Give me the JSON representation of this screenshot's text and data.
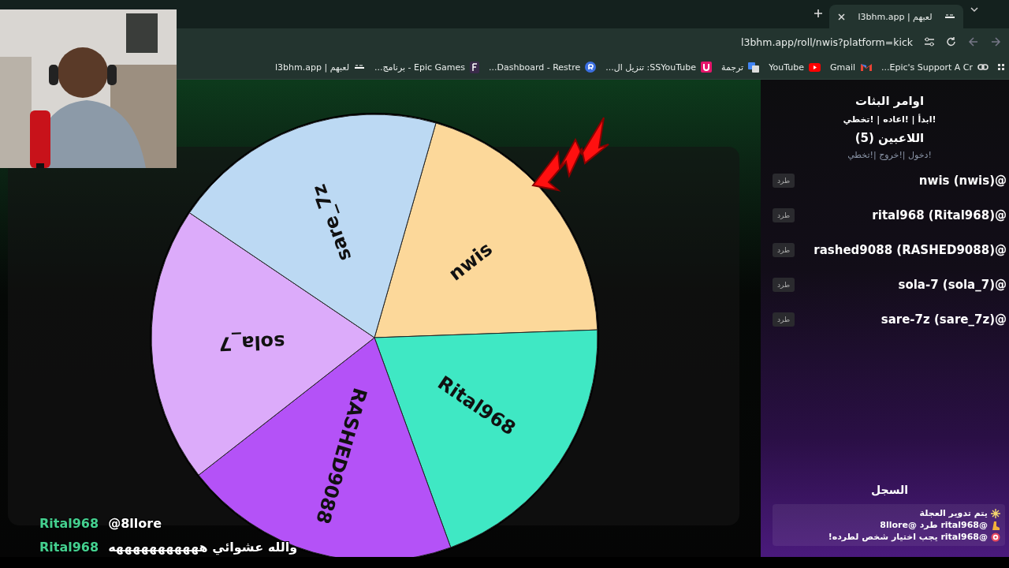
{
  "browser": {
    "tabs": [
      {
        "title": "لعبهم | l3bhm.app",
        "selected": true
      }
    ],
    "url": "l3bhm.app/roll/nwis?platform=kick",
    "bookmarks": [
      {
        "label": "Epic's Support A Cr...",
        "kind": "link"
      },
      {
        "label": "Gmail",
        "kind": "gmail"
      },
      {
        "label": "YouTube",
        "kind": "youtube"
      },
      {
        "label": "ترجمة",
        "kind": "translate"
      },
      {
        "label": "SSYouTube: تنزيل ال...",
        "kind": "ss"
      },
      {
        "label": "Dashboard - Restre...",
        "kind": "restream"
      },
      {
        "label": "Epic Games - برنامج...",
        "kind": "epic"
      },
      {
        "label": "لعبهم | l3bhm.app",
        "kind": "site"
      }
    ]
  },
  "wheel": {
    "segments": [
      {
        "name": "nwis",
        "color": "#fcd89a"
      },
      {
        "name": "Rital968",
        "color": "#3fe8c4"
      },
      {
        "name": "RASHED9088",
        "color": "#b452f7"
      },
      {
        "name": "sola_7",
        "color": "#dcabfa"
      },
      {
        "name": "sare_7z",
        "color": "#bcd9f3"
      }
    ]
  },
  "panel": {
    "title": "اوامر البثات",
    "commands": "!ابدأ | !اعاده | !تخطي",
    "players_title": "اللاعبين (5)",
    "player_commands": "!دخول |!خروج |!تخطي",
    "players": [
      {
        "handle": "@nwis (nwis)",
        "action": "طرد"
      },
      {
        "handle": "@rital968 (Rital968)",
        "action": "طرد"
      },
      {
        "handle": "@rashed9088 (RASHED9088)",
        "action": "طرد"
      },
      {
        "handle": "@sola-7 (sola_7)",
        "action": "طرد"
      },
      {
        "handle": "@sare-7z (sare_7z)",
        "action": "طرد"
      }
    ],
    "log_title": "السجل",
    "log": [
      {
        "kind": "spin",
        "text": "يتم تدوير العجلة"
      },
      {
        "kind": "kick",
        "text": "@rital968 طرد @8llore"
      },
      {
        "kind": "target",
        "text": "@rital968 يجب اختيار شخص لطرده!"
      }
    ]
  },
  "chat": [
    {
      "user": "Rital968",
      "message": "@8llore"
    },
    {
      "user": "Rital968",
      "message": "والله عشوائي هههههههههههه"
    }
  ]
}
